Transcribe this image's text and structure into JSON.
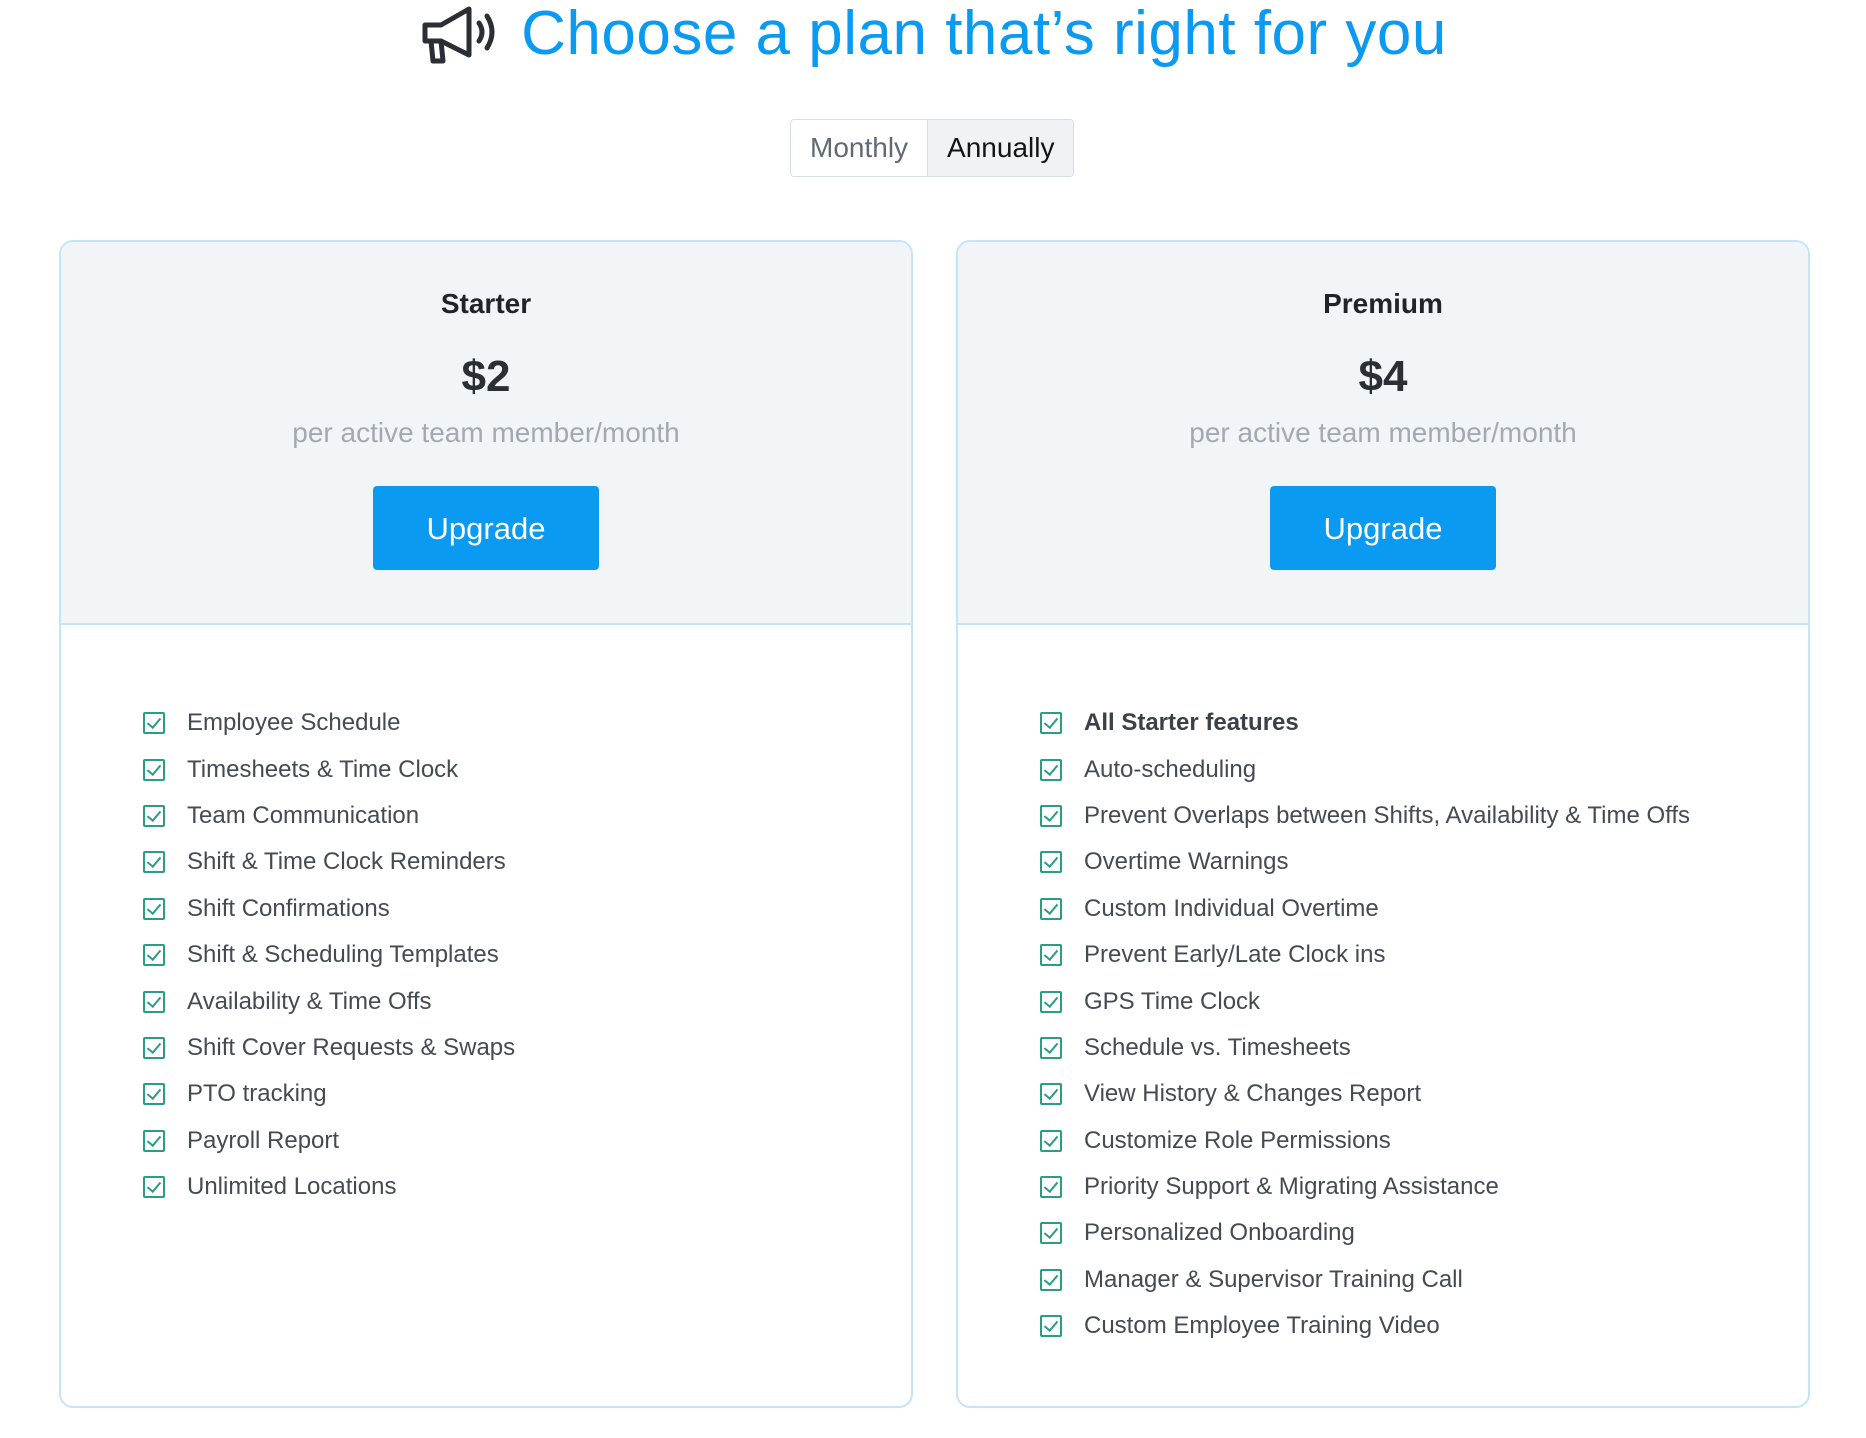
{
  "header": {
    "title": "Choose a plan that’s right for you",
    "icon": "megaphone-icon"
  },
  "billing_toggle": {
    "options": [
      "Monthly",
      "Annually"
    ],
    "selected": "Annually"
  },
  "plans": [
    {
      "name": "Starter",
      "price": "$2",
      "unit": "per active team member/month",
      "cta": "Upgrade",
      "features": [
        "Employee Schedule",
        "Timesheets & Time Clock",
        "Team Communication",
        "Shift & Time Clock Reminders",
        "Shift Confirmations",
        "Shift & Scheduling Templates",
        "Availability & Time Offs",
        "Shift Cover Requests & Swaps",
        "PTO tracking",
        "Payroll Report",
        "Unlimited Locations"
      ]
    },
    {
      "name": "Premium",
      "price": "$4",
      "unit": "per active team member/month",
      "cta": "Upgrade",
      "features": [
        "All Starter features",
        "Auto-scheduling",
        "Prevent Overlaps between Shifts, Availability & Time Offs",
        "Overtime Warnings",
        "Custom Individual Overtime",
        "Prevent Early/Late Clock ins",
        "GPS Time Clock",
        "Schedule vs. Timesheets",
        "View History & Changes Report",
        "Customize Role Permissions",
        "Priority Support & Migrating Assistance",
        "Personalized Onboarding",
        "Manager & Supervisor Training Call",
        "Custom Employee Training Video"
      ]
    }
  ],
  "colors": {
    "accent": "#0a9af2",
    "check": "#2b9d84",
    "card_border": "#c5e5f7",
    "card_top_bg": "#f1f5f8"
  }
}
